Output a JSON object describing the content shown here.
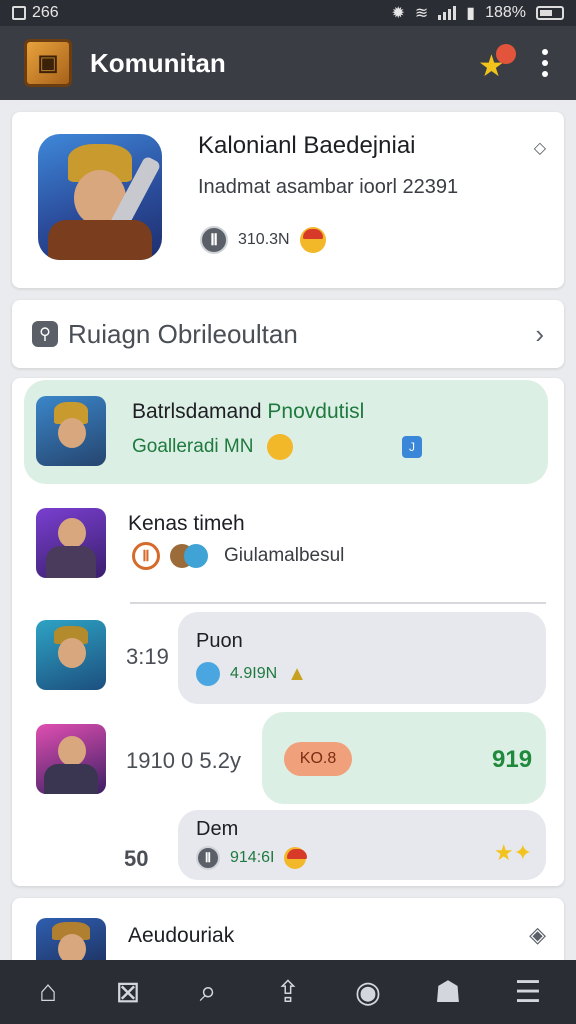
{
  "status_bar": {
    "left_text": "266",
    "battery_text": "188%"
  },
  "app_bar": {
    "title": "Komunitan",
    "logo_icon": "crate-icon",
    "action_icon": "star-badge-icon",
    "menu_icon": "kebab-menu-icon"
  },
  "profile": {
    "name": "Kalonianl Baedejniai",
    "subtitle": "Inadmat asambar ioorl 22391",
    "coin_label": "Ⅱ",
    "stat": "310.3N",
    "collapse_icon": "chevron-up-icon"
  },
  "room_link": {
    "label": "Ruiagn Obrileoultan",
    "icon": "link-icon"
  },
  "feed": {
    "items": [
      {
        "title_black": "Batrlsdamand",
        "title_green": "Pnovdutisl",
        "subtitle": "Goalleradі MN",
        "badge": "J"
      },
      {
        "title": "Kenas timeh",
        "ring_label": "Ⅱ",
        "subtitle": "Giulamalbesul"
      },
      {
        "side_number": "3:19",
        "bubble_title": "Puon",
        "bubble_value": "4.9I9N"
      },
      {
        "side_number": "1910 0 5.2y",
        "pill": "KO.8",
        "big_value": "919"
      },
      {
        "side_number": "50",
        "bubble_title": "Dem",
        "coin_label": "Ⅱ",
        "bubble_value": "914:6I"
      }
    ]
  },
  "last_card": {
    "title": "Aeudouriak"
  },
  "bottom_nav": [
    {
      "name": "nav-home",
      "icon": "home-icon",
      "glyph": "⌂"
    },
    {
      "name": "nav-media",
      "icon": "media-icon",
      "glyph": "⊠"
    },
    {
      "name": "nav-search",
      "icon": "search-icon",
      "glyph": "⌕"
    },
    {
      "name": "nav-upload",
      "icon": "upload-icon",
      "glyph": "⇪"
    },
    {
      "name": "nav-games",
      "icon": "gamepad-icon",
      "glyph": "◉"
    },
    {
      "name": "nav-profile",
      "icon": "profile-icon",
      "glyph": "☗"
    },
    {
      "name": "nav-messages",
      "icon": "messages-icon",
      "glyph": "☰"
    }
  ]
}
